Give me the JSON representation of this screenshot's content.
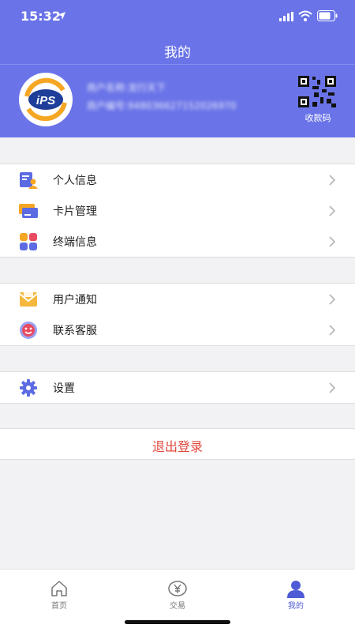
{
  "status_bar": {
    "time": "15:32"
  },
  "nav": {
    "title": "我的"
  },
  "merchant": {
    "name_text": "商户名称:龙行天下",
    "number_text": "商户编号:948036627152026970",
    "qr_label": "收款码"
  },
  "menu_groups": [
    {
      "items": [
        {
          "label": "个人信息",
          "icon": "id-card-icon"
        },
        {
          "label": "卡片管理",
          "icon": "card-icon"
        },
        {
          "label": "终端信息",
          "icon": "terminal-grid-icon"
        }
      ]
    },
    {
      "items": [
        {
          "label": "用户通知",
          "icon": "notification-mail-icon"
        },
        {
          "label": "联系客服",
          "icon": "customer-service-icon"
        }
      ]
    },
    {
      "items": [
        {
          "label": "设置",
          "icon": "gear-icon"
        }
      ]
    }
  ],
  "logout": {
    "label": "退出登录"
  },
  "tabbar": {
    "tabs": [
      {
        "label": "首页",
        "icon": "home-icon"
      },
      {
        "label": "交易",
        "icon": "yen-icon"
      },
      {
        "label": "我的",
        "icon": "user-icon",
        "active": true
      }
    ]
  },
  "colors": {
    "header_bg": "#6a74e8",
    "accent": "#4f5bd5",
    "logout_text": "#e0483d"
  }
}
